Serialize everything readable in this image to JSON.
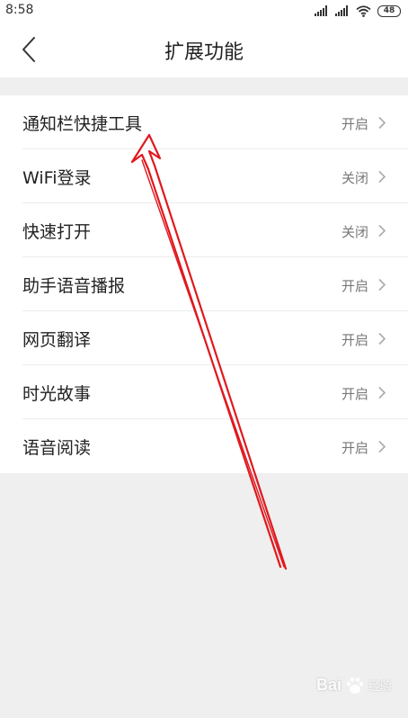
{
  "status_bar": {
    "time": "8:58",
    "battery": "48",
    "icons": [
      "signal-icon",
      "signal-icon",
      "wifi-icon",
      "battery-icon"
    ]
  },
  "header": {
    "title": "扩展功能",
    "back_icon": "chevron-left-icon"
  },
  "settings": [
    {
      "label": "通知栏快捷工具",
      "value": "开启"
    },
    {
      "label": "WiFi登录",
      "value": "关闭"
    },
    {
      "label": "快速打开",
      "value": "关闭"
    },
    {
      "label": "助手语音播报",
      "value": "开启"
    },
    {
      "label": "网页翻译",
      "value": "开启"
    },
    {
      "label": "时光故事",
      "value": "开启"
    },
    {
      "label": "语音阅读",
      "value": "开启"
    }
  ],
  "watermark": {
    "brand": "Bai",
    "sub": "经验"
  },
  "colors": {
    "background": "#efefef",
    "surface": "#ffffff",
    "annotation_arrow": "#e0191f",
    "secondary_text": "#777777"
  }
}
